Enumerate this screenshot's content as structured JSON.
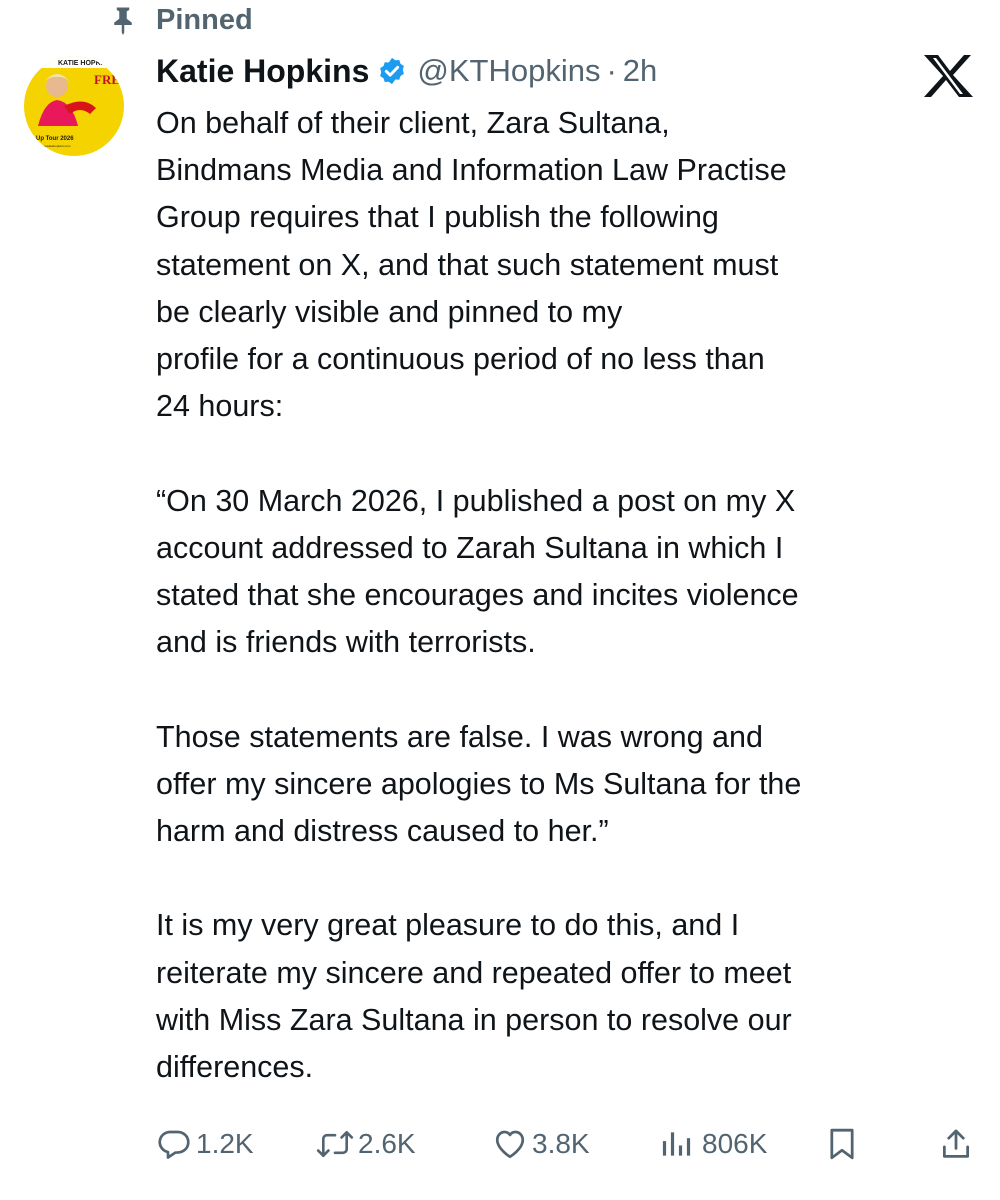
{
  "pinned": {
    "label": "Pinned",
    "icon": "pin-icon"
  },
  "author": {
    "display_name": "Katie Hopkins",
    "handle": "@KTHopkins",
    "separator": "·",
    "time": "2h",
    "verified_icon": "verified-badge-icon",
    "avatar_text": {
      "name": "KATIE HOPKINS",
      "show": "FREE RANGE",
      "tour": "Up Tour 2026",
      "website": "www.katiehopkins.com"
    }
  },
  "platform": {
    "logo": "x-logo-icon"
  },
  "tweet": {
    "paragraphs": [
      [
        "On behalf of their client, Zara Sultana,",
        "Bindmans Media and Information Law Practise",
        "Group requires that I publish the following",
        "statement on X, and that such statement must",
        "be clearly visible and pinned to my",
        "profile for a continuous period of no less than",
        "24 hours:"
      ],
      [
        "“On 30 March 2026, I published a post on my X",
        "account addressed to Zarah Sultana in which I",
        "stated that she encourages and incites violence",
        "and is friends with terrorists."
      ],
      [
        "Those statements are false. I was wrong and",
        "offer my sincere apologies to Ms Sultana for the",
        "harm and distress caused to her.”"
      ],
      [
        "It is my very great pleasure to do this, and I",
        "reiterate my sincere and repeated offer to meet",
        "with Miss Zara Sultana in person to resolve our",
        "differences."
      ]
    ]
  },
  "actions": {
    "reply": {
      "icon": "reply-icon",
      "count": "1.2K"
    },
    "repost": {
      "icon": "repost-icon",
      "count": "2.6K"
    },
    "like": {
      "icon": "heart-icon",
      "count": "3.8K"
    },
    "views": {
      "icon": "views-icon",
      "count": "806K"
    },
    "bookmark": {
      "icon": "bookmark-icon"
    },
    "share": {
      "icon": "share-icon"
    }
  },
  "colors": {
    "text_primary": "#0f1419",
    "text_secondary": "#536471",
    "verified_blue": "#1d9bf0",
    "avatar_background": "#f4d300"
  }
}
